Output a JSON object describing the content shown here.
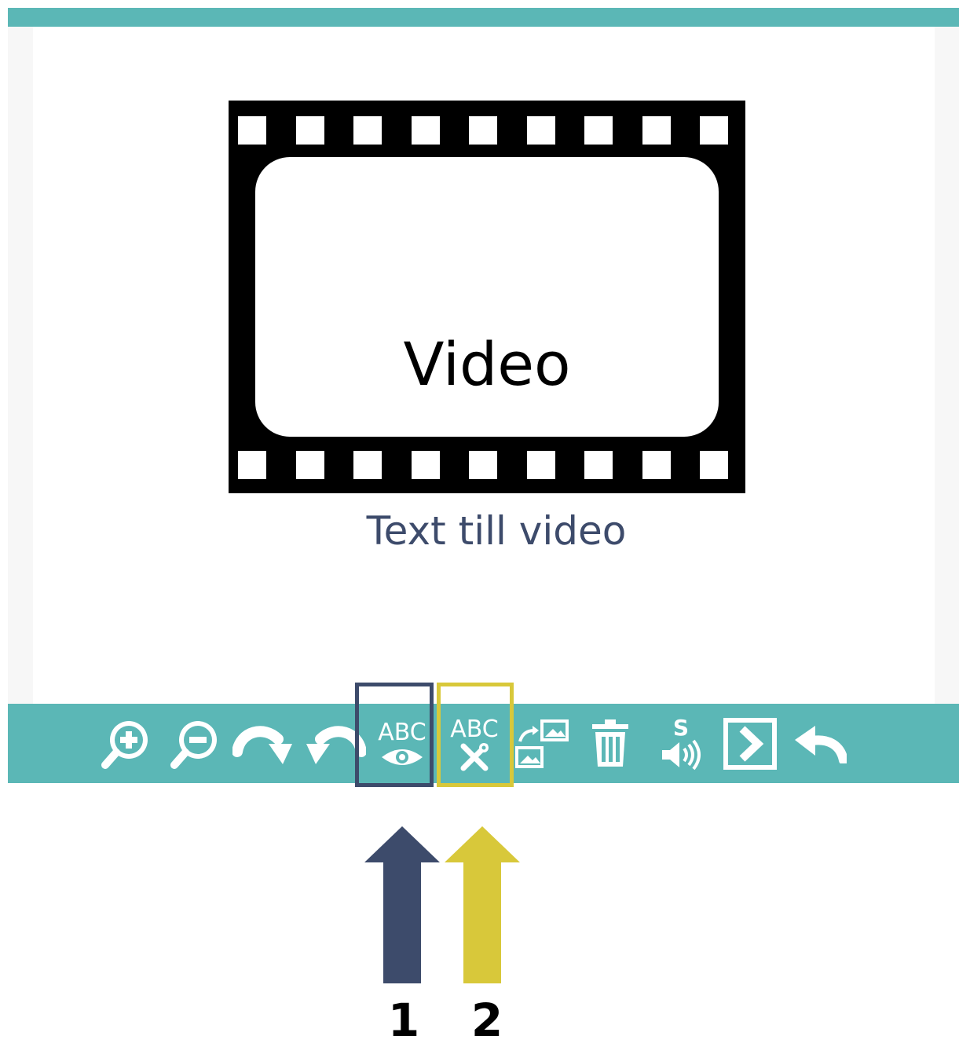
{
  "video": {
    "label": "Video",
    "caption": "Text till video"
  },
  "toolbar": {
    "text_view_label": "ABC",
    "text_edit_label": "ABC",
    "speech_label": "S"
  },
  "annotations": {
    "marker_1": "1",
    "marker_2": "2"
  },
  "colors": {
    "teal": "#5bb7b6",
    "navy": "#3d4b6b",
    "yellow": "#d8c83a"
  },
  "icons": [
    "zoom-in-icon",
    "zoom-out-icon",
    "redo-icon",
    "undo-icon",
    "text-view-icon",
    "text-edit-icon",
    "swap-image-icon",
    "trash-icon",
    "speech-icon",
    "next-icon",
    "back-icon"
  ]
}
